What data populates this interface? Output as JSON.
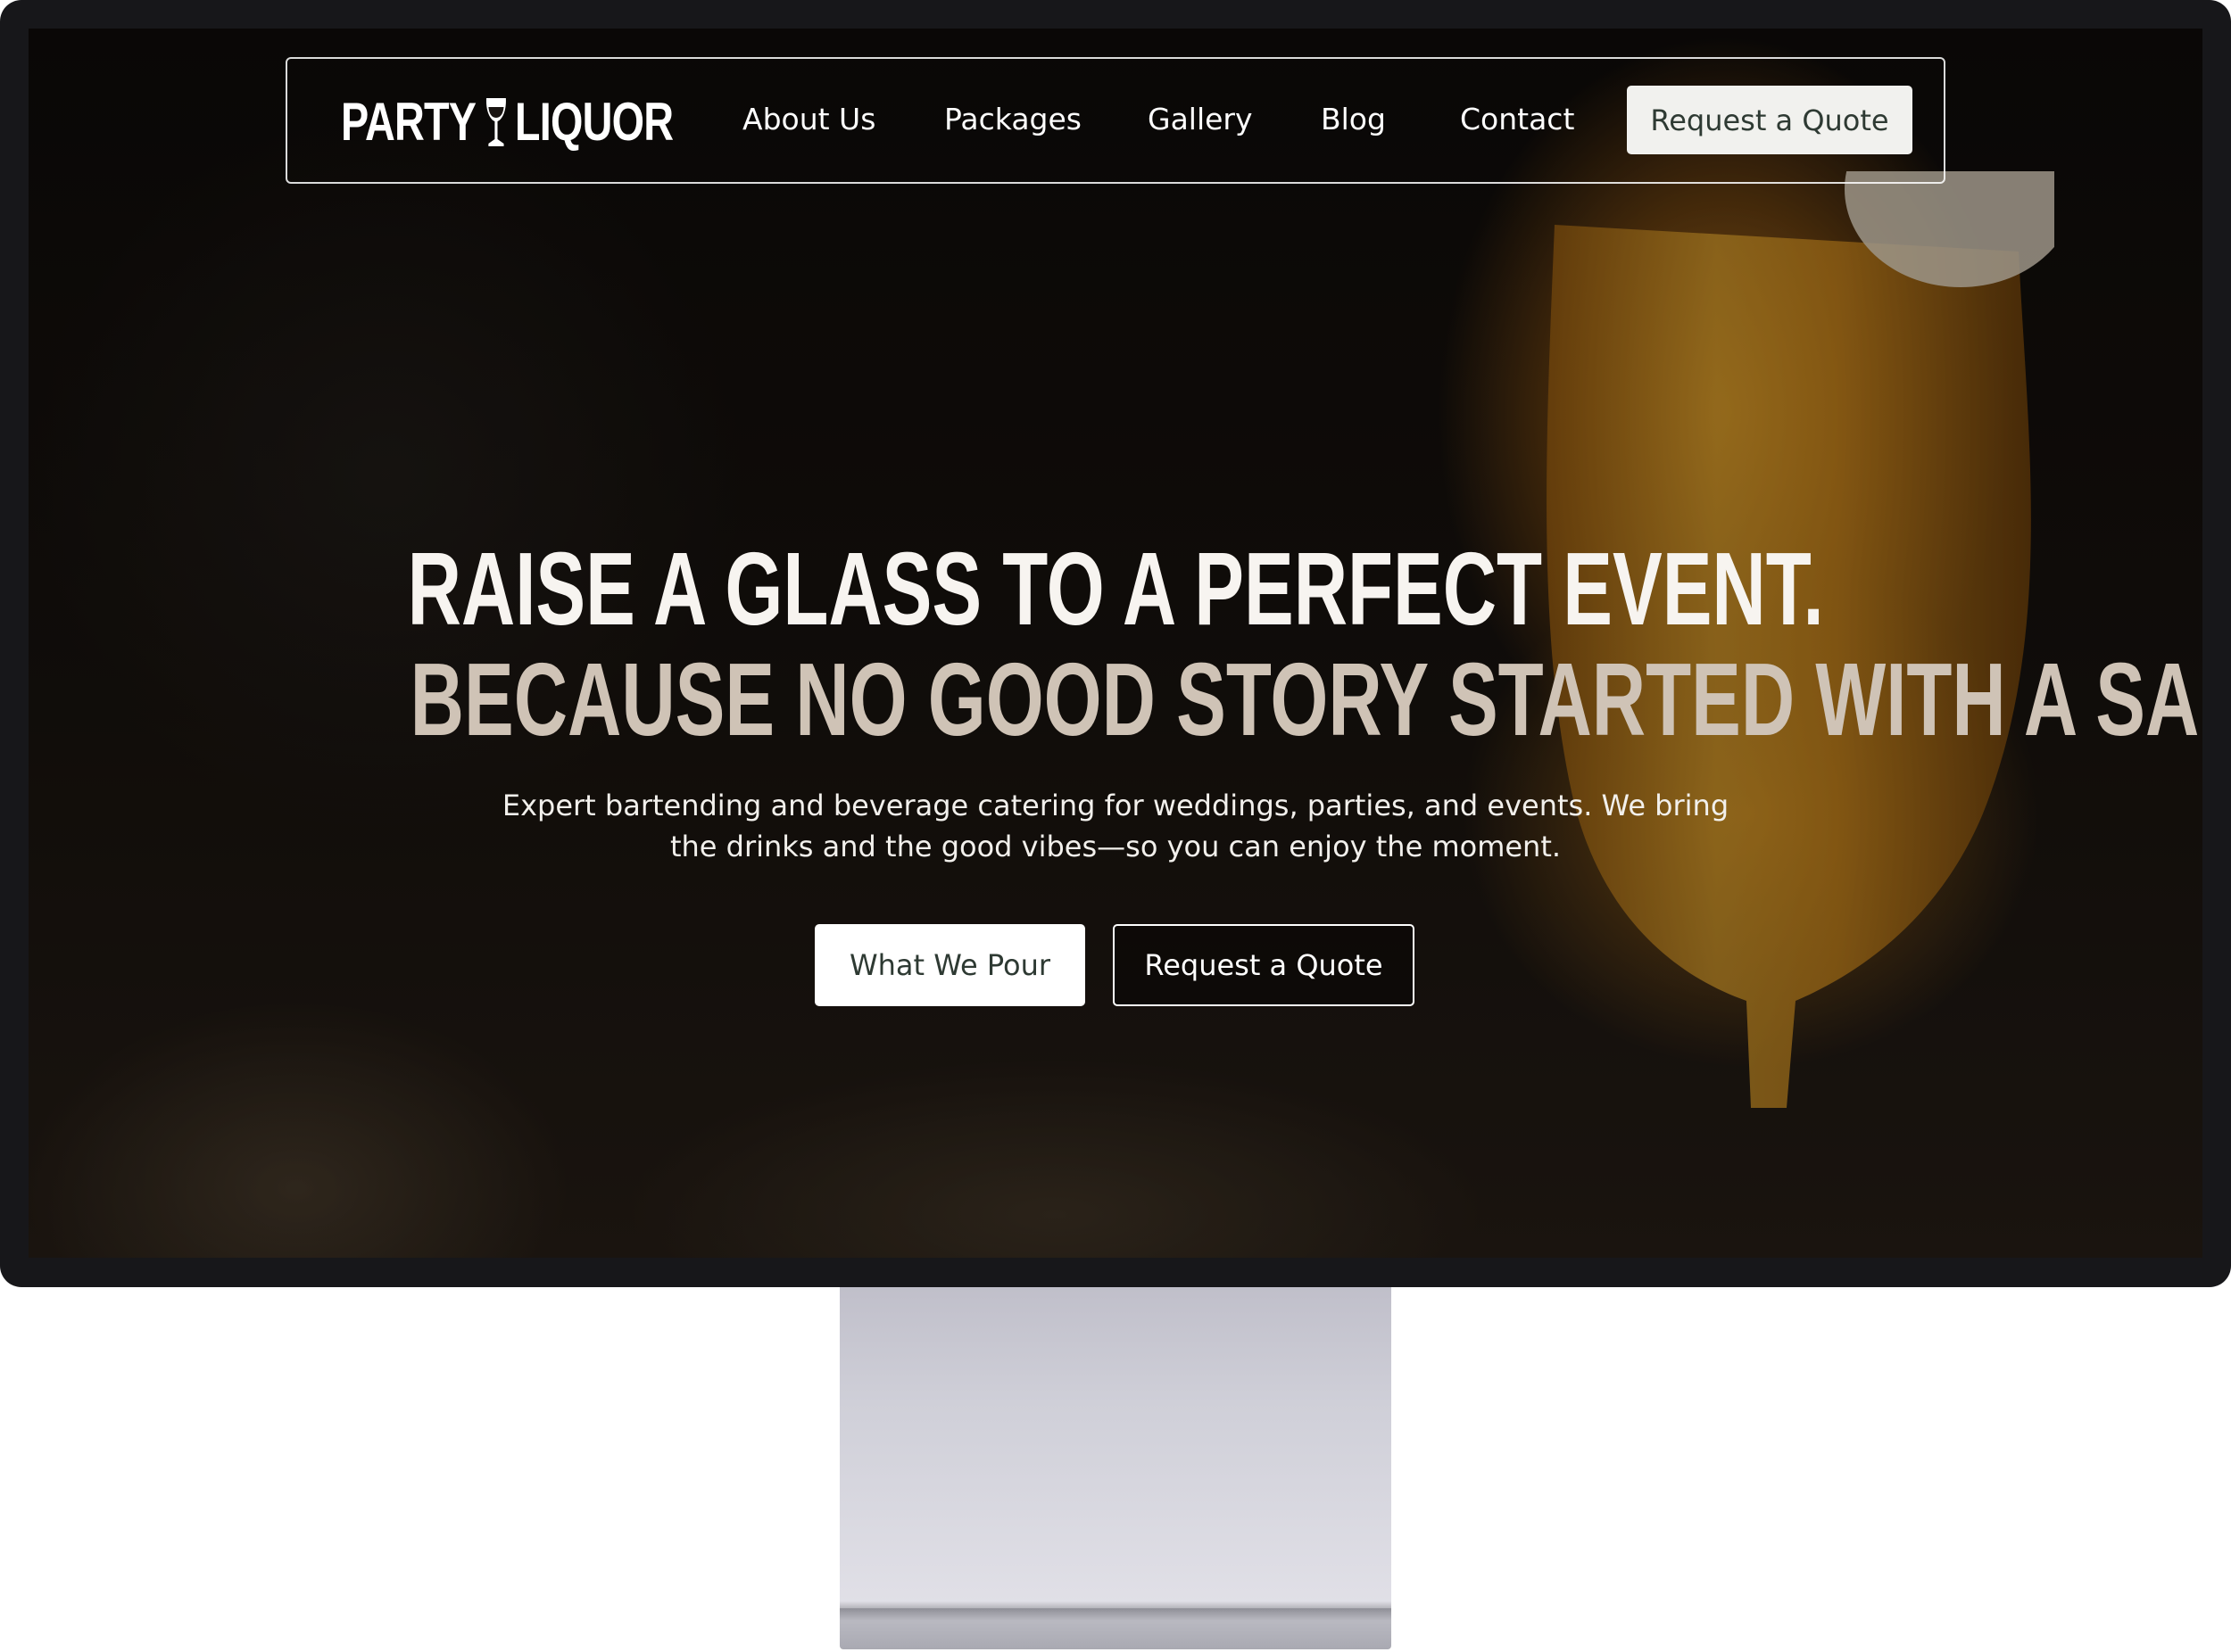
{
  "brand": {
    "name_left": "PARTY",
    "name_right": "LIQUOR",
    "icon": "wine-glass-icon"
  },
  "nav": {
    "items": [
      {
        "label": "About Us"
      },
      {
        "label": "Packages"
      },
      {
        "label": "Gallery"
      },
      {
        "label": "Blog"
      },
      {
        "label": "Contact"
      }
    ],
    "cta_label": "Request a Quote"
  },
  "hero": {
    "headline_line1": "RAISE A GLASS TO A PERFECT EVENT.",
    "headline_line2": "BECAUSE NO GOOD STORY STARTED WITH A SALAD.",
    "subtext_line1": "Expert bartending and beverage catering for weddings, parties, and events. We bring",
    "subtext_line2": "the drinks and the good vibes—so you can enjoy the moment.",
    "primary_button": "What We Pour",
    "secondary_button": "Request a Quote"
  },
  "colors": {
    "headline_primary": "#f7f4f0",
    "headline_secondary": "#cfc3b6",
    "button_text_dark": "#2e3a33",
    "monitor_bezel": "#17171a"
  }
}
